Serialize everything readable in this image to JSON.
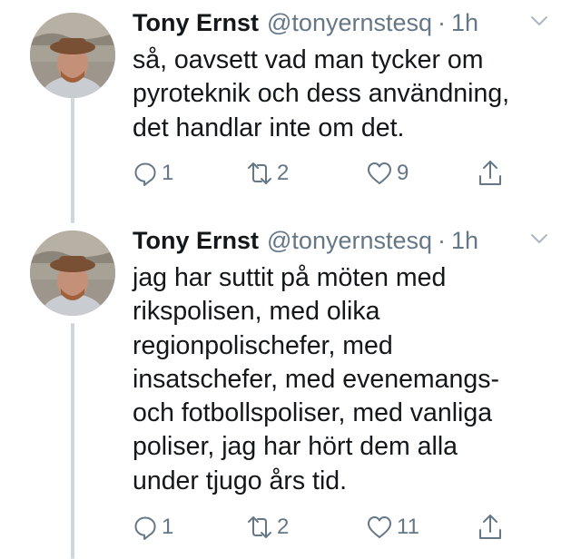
{
  "colors": {
    "text": "#14171a",
    "secondary": "#657786",
    "thread_line": "#cfd6dc"
  },
  "tweets": [
    {
      "author_name": "Tony Ernst",
      "handle": "@tonyernstesq",
      "separator": "·",
      "time": "1h",
      "text": "så, oavsett vad man tycker om\npyroteknik och dess användning,\ndet handlar inte om det.",
      "replies": "1",
      "retweets": "2",
      "likes": "9",
      "icons": [
        "reply-icon",
        "retweet-icon",
        "like-icon",
        "share-icon",
        "chevron-down-icon"
      ]
    },
    {
      "author_name": "Tony Ernst",
      "handle": "@tonyernstesq",
      "separator": "·",
      "time": "1h",
      "text": "jag har suttit på möten med\nrikspolisen, med olika\nregionpolischefer, med\ninsatschefer, med evenemangs-\noch fotbollspoliser, med vanliga\npoliser, jag har hört dem alla\nunder tjugo års tid.",
      "replies": "1",
      "retweets": "2",
      "likes": "11",
      "icons": [
        "reply-icon",
        "retweet-icon",
        "like-icon",
        "share-icon",
        "chevron-down-icon"
      ]
    }
  ]
}
